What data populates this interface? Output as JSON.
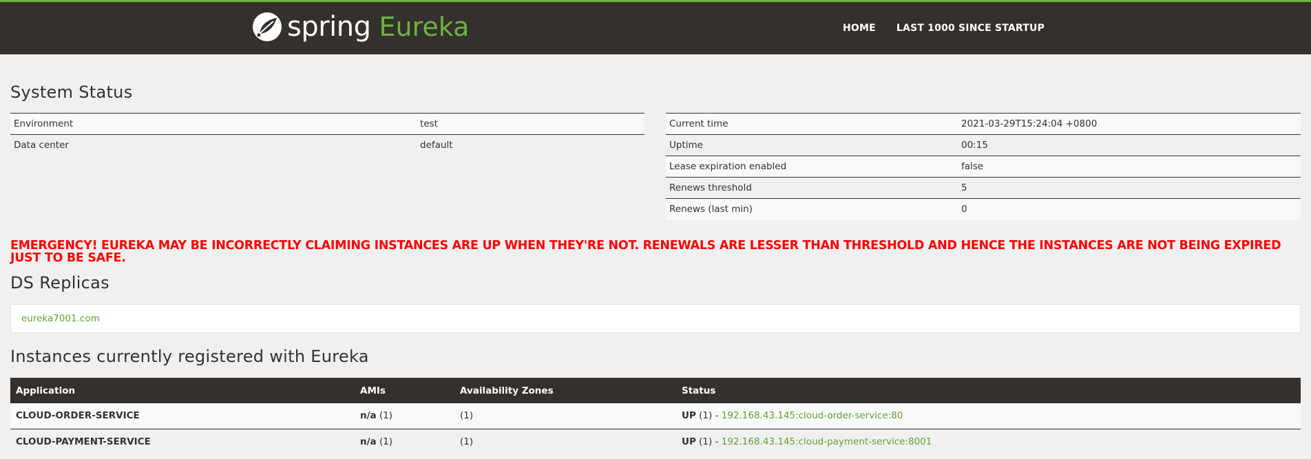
{
  "brand": {
    "spring": "spring",
    "eureka": "Eureka"
  },
  "nav": {
    "home": "HOME",
    "last1000": "LAST 1000 SINCE STARTUP"
  },
  "system_status": {
    "title": "System Status",
    "left": [
      {
        "label": "Environment",
        "value": "test"
      },
      {
        "label": "Data center",
        "value": "default"
      }
    ],
    "right": [
      {
        "label": "Current time",
        "value": "2021-03-29T15:24:04 +0800"
      },
      {
        "label": "Uptime",
        "value": "00:15"
      },
      {
        "label": "Lease expiration enabled",
        "value": "false"
      },
      {
        "label": "Renews threshold",
        "value": "5"
      },
      {
        "label": "Renews (last min)",
        "value": "0"
      }
    ]
  },
  "emergency": "EMERGENCY! EUREKA MAY BE INCORRECTLY CLAIMING INSTANCES ARE UP WHEN THEY'RE NOT. RENEWALS ARE LESSER THAN THRESHOLD AND HENCE THE INSTANCES ARE NOT BEING EXPIRED JUST TO BE SAFE.",
  "ds_replicas": {
    "title": "DS Replicas",
    "link": "eureka7001.com"
  },
  "instances": {
    "title": "Instances currently registered with Eureka",
    "headers": [
      "Application",
      "AMIs",
      "Availability Zones",
      "Status"
    ],
    "rows": [
      {
        "app": "CLOUD-ORDER-SERVICE",
        "ami": "n/a",
        "ami_count": " (1)",
        "zones": "(1)",
        "status": "UP",
        "status_count": " (1) - ",
        "link": "192.168.43.145:cloud-order-service:80"
      },
      {
        "app": "CLOUD-PAYMENT-SERVICE",
        "ami": "n/a",
        "ami_count": " (1)",
        "zones": "(1)",
        "status": "UP",
        "status_count": " (1) - ",
        "link": "192.168.43.145:cloud-payment-service:8001"
      }
    ]
  },
  "colors": {
    "nav_bg": "#34302d",
    "accent": "#6db33f",
    "emergency": "#ff0000"
  }
}
